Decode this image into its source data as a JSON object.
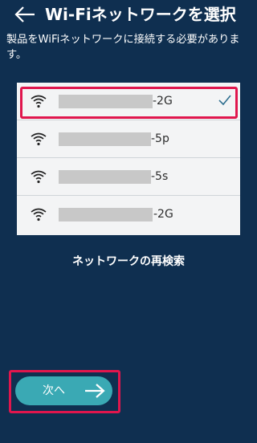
{
  "header": {
    "title": "Wi-Fiネットワークを選択",
    "back_icon": "arrow-left-icon"
  },
  "subtitle": "製品をWiFiネットワークに接続する必要があります。",
  "wifi_list": [
    {
      "ssid_suffix": "-2G",
      "selected": true,
      "icon": "wifi-icon"
    },
    {
      "ssid_suffix": "-5p",
      "selected": false,
      "icon": "wifi-icon"
    },
    {
      "ssid_suffix": "-5s",
      "selected": false,
      "icon": "wifi-icon"
    },
    {
      "ssid_suffix": "-2G",
      "selected": false,
      "icon": "wifi-icon"
    }
  ],
  "rescan_label": "ネットワークの再検索",
  "next_button": {
    "label": "次へ",
    "icon": "arrow-right-icon"
  },
  "colors": {
    "background": "#0f2f50",
    "accent": "#3aa9b4",
    "highlight": "#e0164d",
    "check": "#2f6f8f"
  }
}
